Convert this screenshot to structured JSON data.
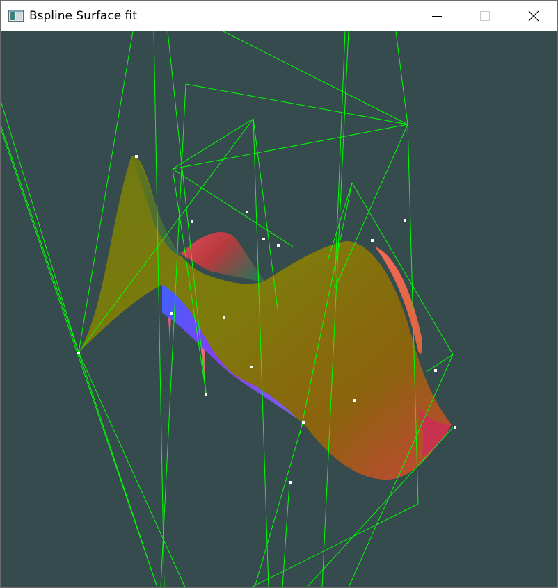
{
  "window": {
    "title": "Bspline Surface fit",
    "icons": {
      "app": "app-window-icon",
      "minimize": "minimize-icon",
      "maximize": "maximize-icon",
      "close": "close-icon"
    }
  },
  "viewport": {
    "background": "#354b4d",
    "control_net_color": "#00ff00",
    "point_color": "#ffffff"
  }
}
